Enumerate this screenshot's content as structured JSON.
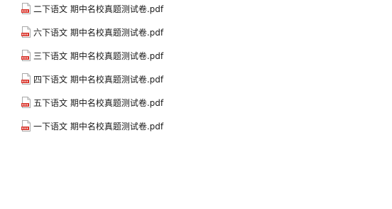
{
  "files": [
    {
      "name": "二下语文 期中名校真题测试卷.pdf",
      "icon": "pdf-file-icon"
    },
    {
      "name": "六下语文 期中名校真题测试卷.pdf",
      "icon": "pdf-file-icon"
    },
    {
      "name": "三下语文 期中名校真题测试卷.pdf",
      "icon": "pdf-file-icon"
    },
    {
      "name": "四下语文 期中名校真题测试卷.pdf",
      "icon": "pdf-file-icon"
    },
    {
      "name": "五下语文 期中名校真题测试卷.pdf",
      "icon": "pdf-file-icon"
    },
    {
      "name": "一下语文 期中名校真题测试卷.pdf",
      "icon": "pdf-file-icon"
    }
  ],
  "colors": {
    "icon_red": "#d9342b",
    "icon_page": "#ffffff",
    "icon_border": "#a8a8a8",
    "text": "#1a1a1a"
  }
}
